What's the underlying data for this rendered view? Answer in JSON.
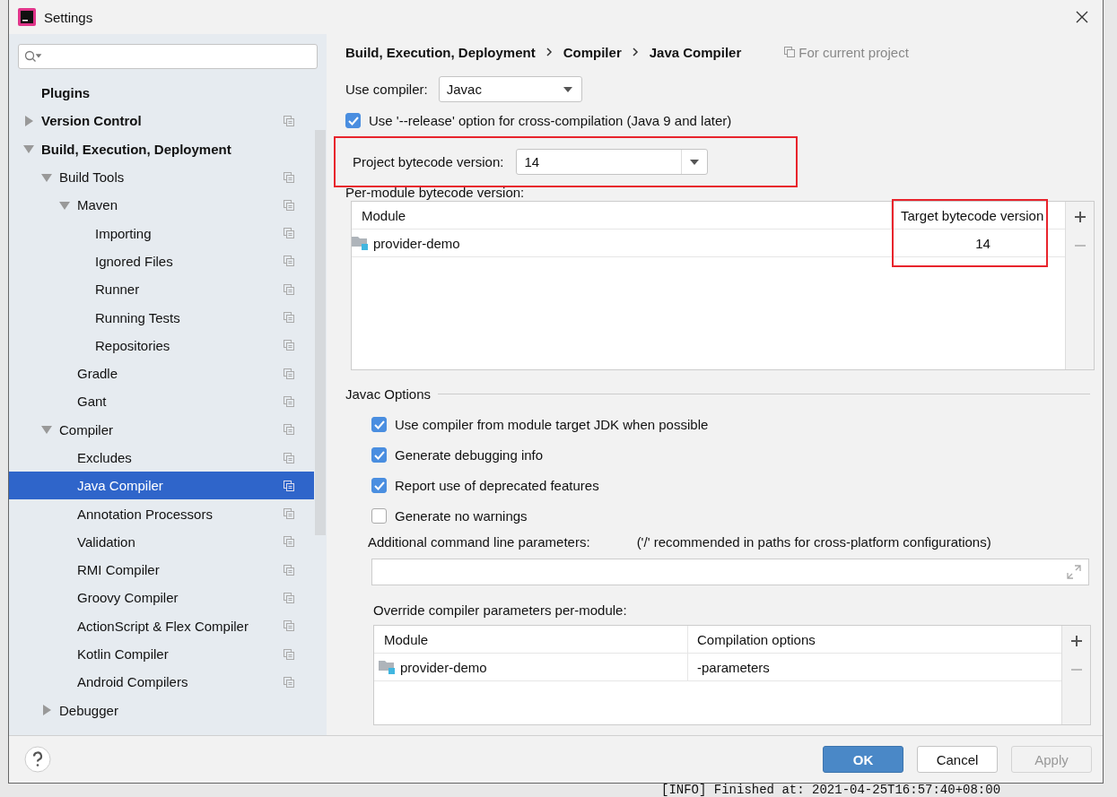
{
  "window": {
    "title": "Settings"
  },
  "sidebar": {
    "items": [
      {
        "label": "Plugins",
        "bold": true,
        "project": false,
        "selected": false
      },
      {
        "label": "Version Control",
        "bold": true,
        "project": true,
        "selected": false,
        "expanded": false
      },
      {
        "label": "Build, Execution, Deployment",
        "bold": true,
        "project": false,
        "selected": false,
        "expanded": true,
        "children": [
          {
            "label": "Build Tools",
            "bold": false,
            "project": true,
            "selected": false,
            "expanded": true,
            "children": [
              {
                "label": "Maven",
                "bold": false,
                "project": true,
                "selected": false,
                "expanded": true,
                "children": [
                  {
                    "label": "Importing",
                    "bold": false,
                    "project": true,
                    "selected": false
                  },
                  {
                    "label": "Ignored Files",
                    "bold": false,
                    "project": true,
                    "selected": false
                  },
                  {
                    "label": "Runner",
                    "bold": false,
                    "project": true,
                    "selected": false
                  },
                  {
                    "label": "Running Tests",
                    "bold": false,
                    "project": true,
                    "selected": false
                  },
                  {
                    "label": "Repositories",
                    "bold": false,
                    "project": true,
                    "selected": false
                  }
                ]
              },
              {
                "label": "Gradle",
                "bold": false,
                "project": true,
                "selected": false
              },
              {
                "label": "Gant",
                "bold": false,
                "project": true,
                "selected": false
              }
            ]
          },
          {
            "label": "Compiler",
            "bold": false,
            "project": true,
            "selected": false,
            "expanded": true,
            "children": [
              {
                "label": "Excludes",
                "bold": false,
                "project": true,
                "selected": false
              },
              {
                "label": "Java Compiler",
                "bold": false,
                "project": true,
                "selected": true
              },
              {
                "label": "Annotation Processors",
                "bold": false,
                "project": true,
                "selected": false
              },
              {
                "label": "Validation",
                "bold": false,
                "project": true,
                "selected": false
              },
              {
                "label": "RMI Compiler",
                "bold": false,
                "project": true,
                "selected": false
              },
              {
                "label": "Groovy Compiler",
                "bold": false,
                "project": true,
                "selected": false
              },
              {
                "label": "ActionScript & Flex Compiler",
                "bold": false,
                "project": true,
                "selected": false
              },
              {
                "label": "Kotlin Compiler",
                "bold": false,
                "project": true,
                "selected": false
              },
              {
                "label": "Android Compilers",
                "bold": false,
                "project": true,
                "selected": false
              }
            ]
          },
          {
            "label": "Debugger",
            "bold": false,
            "project": false,
            "selected": false,
            "expanded": false
          }
        ]
      }
    ]
  },
  "breadcrumb": [
    "Build, Execution, Deployment",
    "Compiler",
    "Java Compiler"
  ],
  "scope_note": "For current project",
  "use_compiler": {
    "label": "Use compiler:",
    "value": "Javac"
  },
  "release_option": {
    "label": "Use '--release' option for cross-compilation (Java 9 and later)",
    "checked": true
  },
  "project_bytecode": {
    "label": "Project bytecode version:",
    "value": "14",
    "highlighted": true
  },
  "per_module": {
    "label": "Per-module bytecode version:",
    "columns": [
      "Module",
      "Target bytecode version"
    ],
    "highlight_target": true,
    "rows": [
      {
        "module": "provider-demo",
        "version": "14"
      }
    ]
  },
  "javac": {
    "title": "Javac Options",
    "options": [
      {
        "label": "Use compiler from module target JDK when possible",
        "checked": true
      },
      {
        "label": "Generate debugging info",
        "checked": true
      },
      {
        "label": "Report use of deprecated features",
        "checked": true
      },
      {
        "label": "Generate no warnings",
        "checked": false
      }
    ],
    "params_label": "Additional command line parameters:",
    "params_hint": "('/' recommended in paths for cross-platform configurations)",
    "override_label": "Override compiler parameters per-module:",
    "override_columns": [
      "Module",
      "Compilation options"
    ],
    "override_rows": [
      {
        "module": "provider-demo",
        "options": "-parameters"
      }
    ]
  },
  "buttons": [
    {
      "label": "OK",
      "kind": "primary",
      "disabled": false
    },
    {
      "label": "Cancel",
      "kind": "normal",
      "disabled": false
    },
    {
      "label": "Apply",
      "kind": "normal",
      "disabled": true
    }
  ],
  "background_log": "[INFO] Finished at: 2021-04-25T16:57:40+08:00"
}
